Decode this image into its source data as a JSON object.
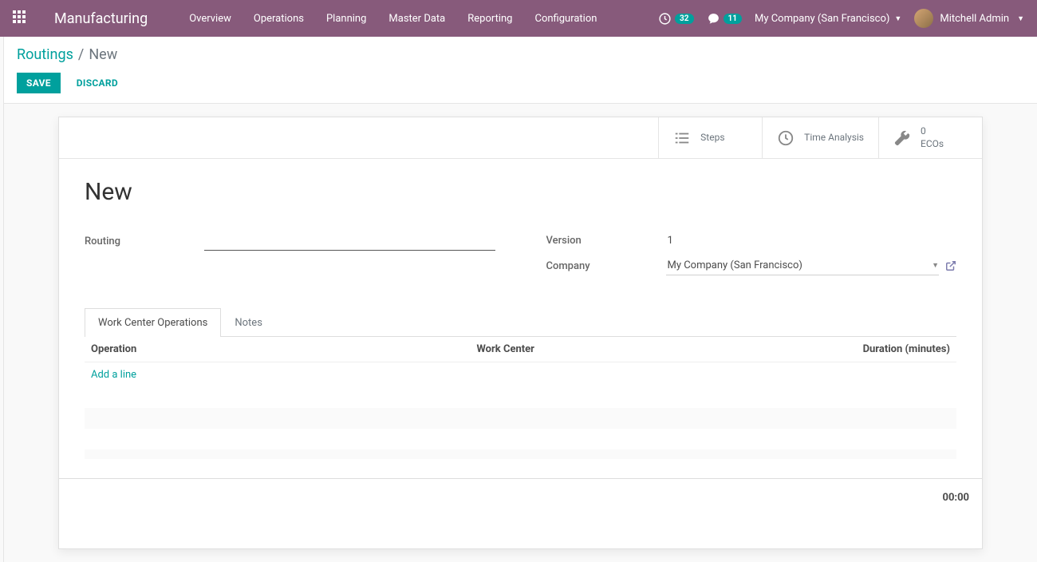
{
  "nav": {
    "brand": "Manufacturing",
    "items": [
      "Overview",
      "Operations",
      "Planning",
      "Master Data",
      "Reporting",
      "Configuration"
    ],
    "activity_badge": "32",
    "discuss_badge": "11",
    "company": "My Company (San Francisco)",
    "user": "Mitchell Admin"
  },
  "breadcrumbs": {
    "root": "Routings",
    "current": "New"
  },
  "buttons": {
    "save": "Save",
    "discard": "Discard"
  },
  "stat_buttons": {
    "steps": "Steps",
    "time": "Time Analysis",
    "ecos_value": "0",
    "ecos_label": "ECOs"
  },
  "form": {
    "title": "New",
    "labels": {
      "routing": "Routing",
      "version": "Version",
      "company": "Company"
    },
    "values": {
      "routing": "",
      "version": "1",
      "company": "My Company (San Francisco)"
    }
  },
  "tabs": {
    "operations": "Work Center Operations",
    "notes": "Notes"
  },
  "grid": {
    "cols": {
      "operation": "Operation",
      "workcenter": "Work Center",
      "duration": "Duration (minutes)"
    },
    "add": "Add a line",
    "total": "00:00"
  }
}
